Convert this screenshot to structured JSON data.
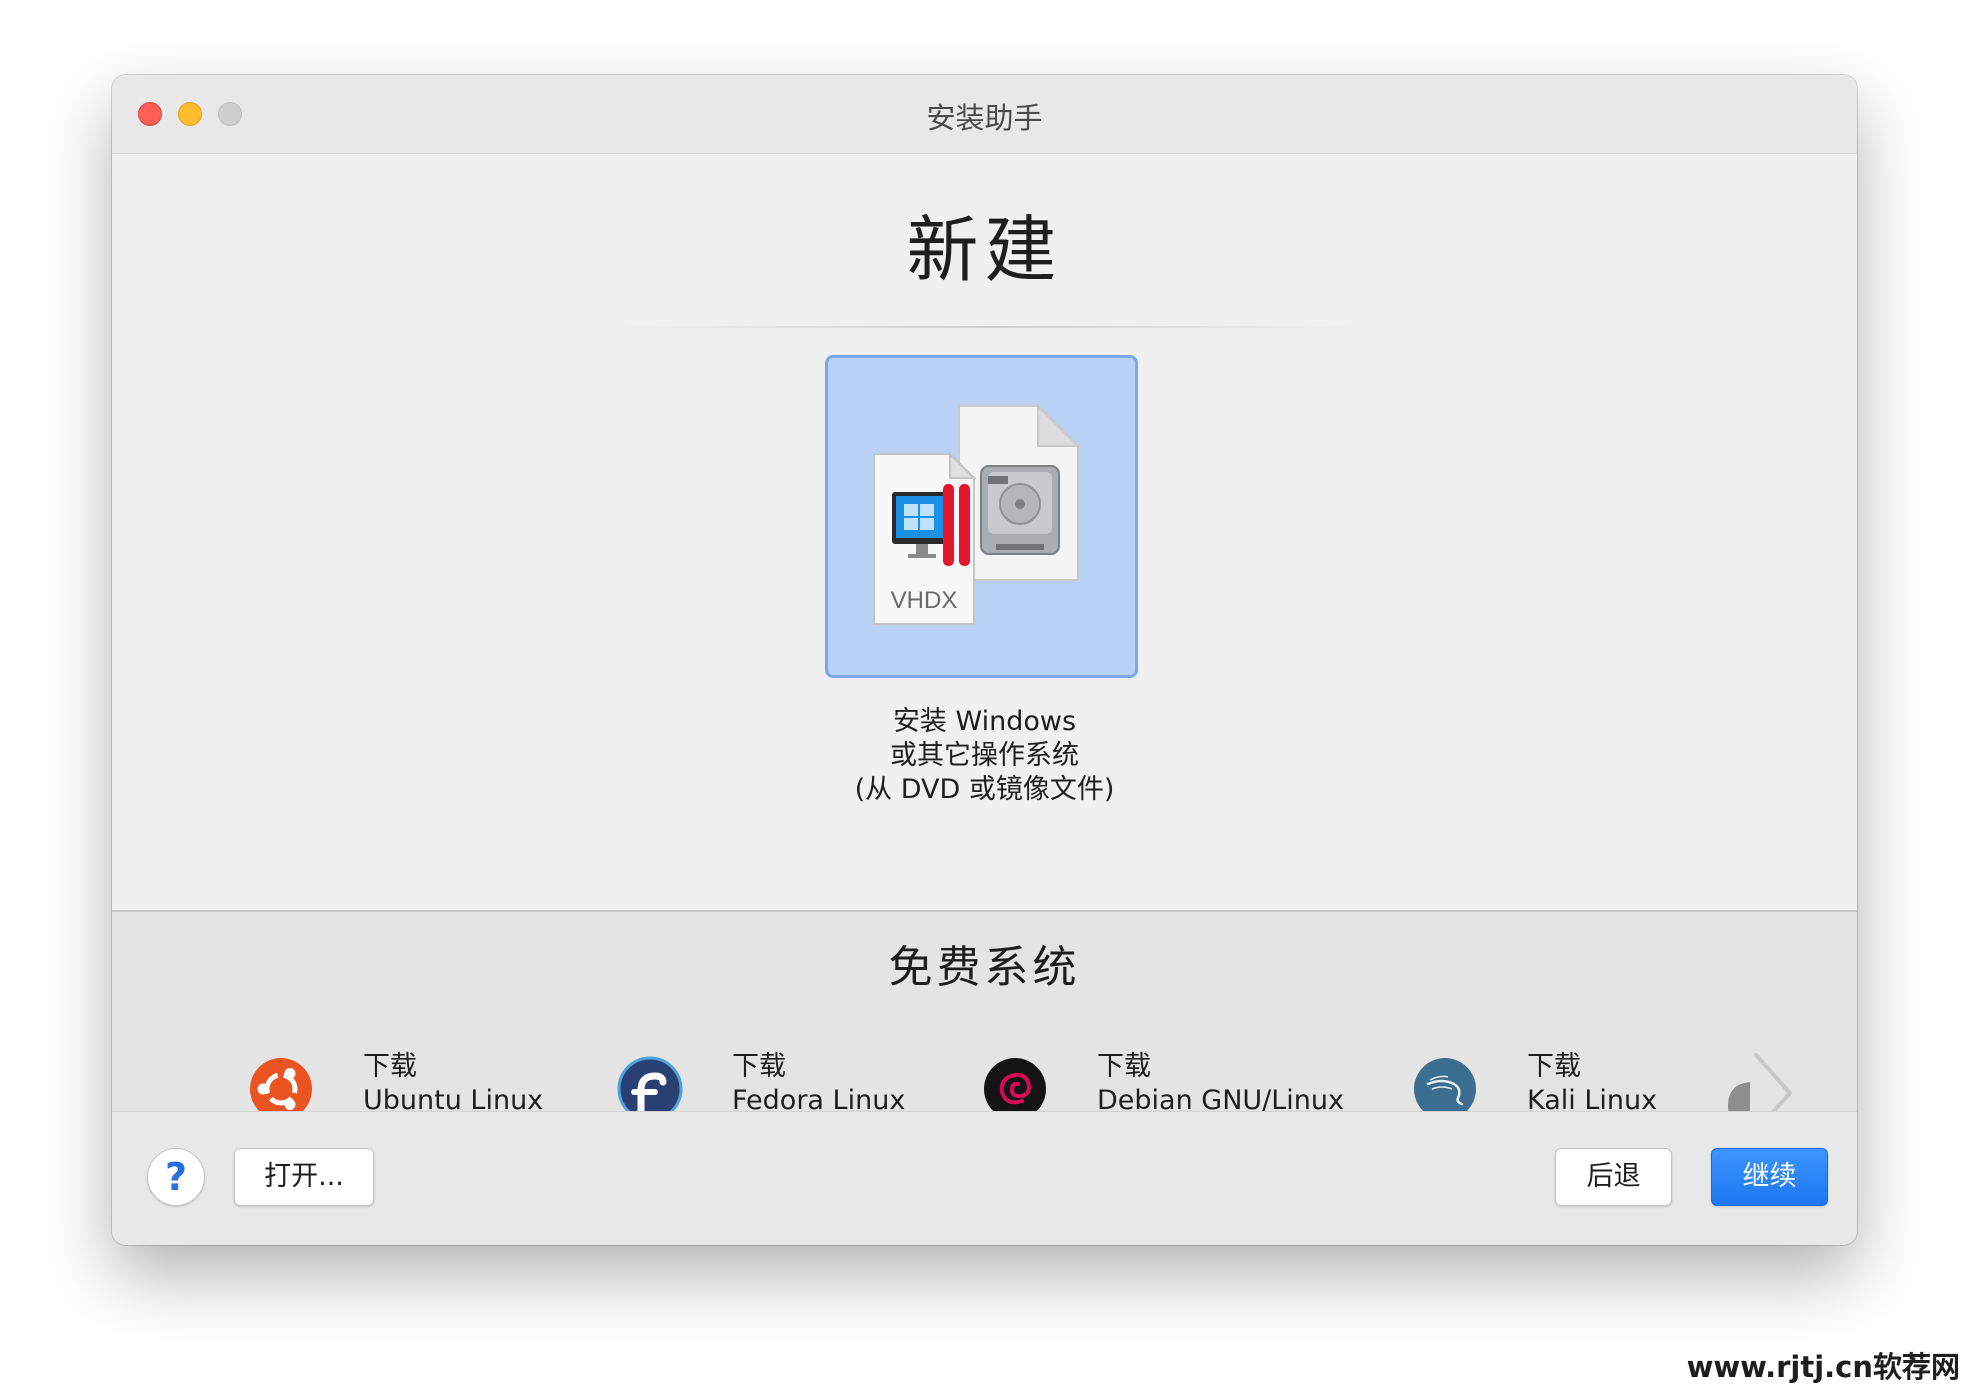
{
  "window": {
    "title": "安装助手"
  },
  "main": {
    "heading": "新建",
    "tile": {
      "file_label": "VHDX",
      "caption_lines": [
        "安装 Windows",
        "或其它操作系统",
        "(从 DVD 或镜像文件)"
      ]
    }
  },
  "free_systems": {
    "heading": "免费系统",
    "items": [
      {
        "action": "下载",
        "name": "Ubuntu Linux",
        "icon": "ubuntu-logo-icon",
        "color": "#e95420"
      },
      {
        "action": "下载",
        "name": "Fedora Linux",
        "icon": "fedora-logo-icon",
        "color": "#294172"
      },
      {
        "action": "下载",
        "name": "Debian GNU/Linux",
        "icon": "debian-logo-icon",
        "color": "#d70a53"
      },
      {
        "action": "下载",
        "name": "Kali Linux",
        "icon": "kali-logo-icon",
        "color": "#3c6e8f"
      }
    ]
  },
  "footer": {
    "help_label": "?",
    "open_label": "打开...",
    "back_label": "后退",
    "continue_label": "继续"
  },
  "watermark": "www.rjtj.cn软荐网",
  "colors": {
    "accent": "#1d78f2",
    "tile_bg": "#b9d2f5",
    "tile_border": "#7aa8ea"
  }
}
